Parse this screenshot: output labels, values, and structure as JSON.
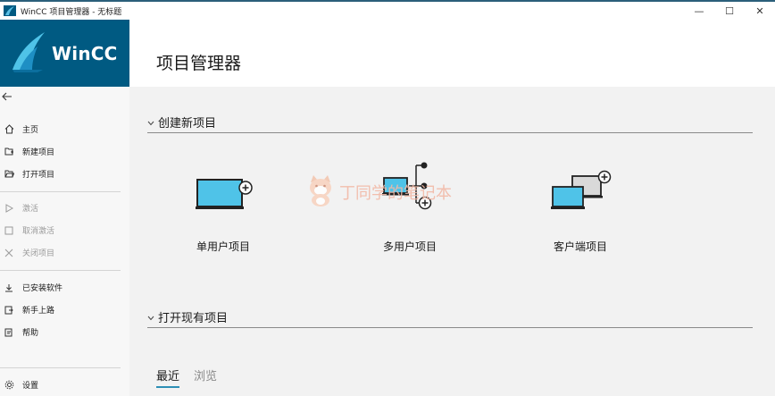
{
  "window": {
    "title": "WinCC 项目管理器 - 无标题",
    "controls": {
      "minimize": "—",
      "maximize": "☐",
      "close": "✕"
    }
  },
  "sidebar": {
    "brand": "WinCC",
    "back_icon": "arrow-left-icon",
    "groups": [
      [
        {
          "label": "主页",
          "icon": "home-icon",
          "enabled": true
        },
        {
          "label": "新建项目",
          "icon": "new-project-icon",
          "enabled": true
        },
        {
          "label": "打开项目",
          "icon": "open-folder-icon",
          "enabled": true
        }
      ],
      [
        {
          "label": "激活",
          "icon": "play-icon",
          "enabled": false
        },
        {
          "label": "取消激活",
          "icon": "stop-icon",
          "enabled": false
        },
        {
          "label": "关闭项目",
          "icon": "close-icon",
          "enabled": false
        }
      ],
      [
        {
          "label": "已安装软件",
          "icon": "download-icon",
          "enabled": true
        },
        {
          "label": "新手上路",
          "icon": "getting-started-icon",
          "enabled": true
        },
        {
          "label": "帮助",
          "icon": "help-icon",
          "enabled": true
        }
      ]
    ],
    "settings": {
      "label": "设置",
      "icon": "gear-icon"
    }
  },
  "header": {
    "title": "项目管理器"
  },
  "create_section": {
    "title": "创建新项目",
    "tiles": [
      {
        "label": "单用户项目",
        "icon": "single-user-monitor-icon"
      },
      {
        "label": "多用户项目",
        "icon": "multi-user-network-icon"
      },
      {
        "label": "客户端项目",
        "icon": "client-monitors-icon"
      }
    ]
  },
  "watermark": {
    "text": "丁同学的笔记本"
  },
  "open_section": {
    "title": "打开现有项目",
    "tabs": [
      {
        "label": "最近",
        "active": true
      },
      {
        "label": "浏览",
        "active": false
      }
    ]
  },
  "colors": {
    "brand": "#005a82",
    "screen_blue": "#4fc3e8",
    "accent_underline": "#2d8fb5"
  }
}
